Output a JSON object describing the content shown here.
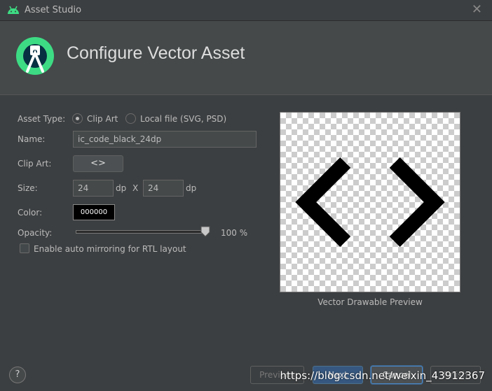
{
  "window": {
    "title": "Asset Studio",
    "close_glyph": "✕"
  },
  "header": {
    "title": "Configure Vector Asset"
  },
  "form": {
    "asset_type_label": "Asset Type:",
    "asset_type_options": [
      {
        "label": "Clip Art",
        "selected": true
      },
      {
        "label": "Local file (SVG, PSD)",
        "selected": false
      }
    ],
    "name_label": "Name:",
    "name_value": "ic_code_black_24dp",
    "clip_art_label": "Clip Art:",
    "clip_art_icon": "code-icon",
    "clip_art_glyph": "<>",
    "size_label": "Size:",
    "width_value": "24",
    "height_value": "24",
    "unit": "dp",
    "size_separator": "X",
    "color_label": "Color:",
    "color_value": "000000",
    "opacity_label": "Opacity:",
    "opacity_fraction": 1.0,
    "opacity_value": "100 %",
    "rtl_label": "Enable auto mirroring for RTL layout",
    "rtl_checked": false
  },
  "preview": {
    "caption": "Vector Drawable Preview",
    "icon": "code-icon"
  },
  "footer": {
    "help_glyph": "?",
    "buttons": {
      "previous": "Previous",
      "next": "Next",
      "cancel": "Cancel",
      "finish": "Finish"
    }
  },
  "watermark": "https://blog.csdn.net/weixin_43912367",
  "colors": {
    "background": "#3c3f41",
    "header_bg": "#45494a",
    "android_green": "#3ddc84",
    "primary_button": "#365880"
  }
}
